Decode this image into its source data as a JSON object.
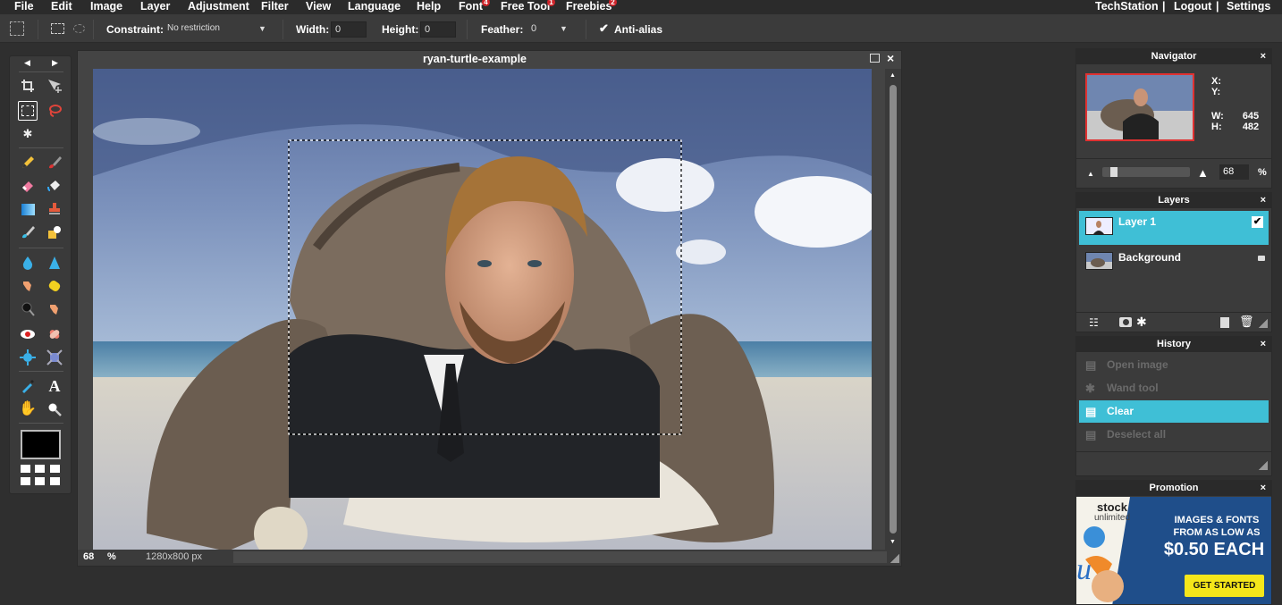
{
  "menu": {
    "items": [
      {
        "label": "File"
      },
      {
        "label": "Edit"
      },
      {
        "label": "Image"
      },
      {
        "label": "Layer"
      },
      {
        "label": "Adjustment"
      },
      {
        "label": "Filter"
      },
      {
        "label": "View"
      },
      {
        "label": "Language"
      },
      {
        "label": "Help"
      },
      {
        "label": "Font",
        "badge": "4"
      },
      {
        "label": "Free Tool",
        "badge": "1"
      },
      {
        "label": "Freebies",
        "badge": "2"
      }
    ],
    "right": {
      "site": "TechStation",
      "sep1": "|",
      "logout": "Logout",
      "sep2": "|",
      "settings": "Settings"
    }
  },
  "options": {
    "constraint_label": "Constraint:",
    "constraint_value": "No restriction",
    "width_label": "Width:",
    "width_value": "0",
    "height_label": "Height:",
    "height_value": "0",
    "feather_label": "Feather:",
    "feather_value": "0",
    "antialias_label": "Anti-alias",
    "antialias_checked": true
  },
  "toolbox": {
    "selected_tool": "rectangular-marquee",
    "foreground_color": "#000000",
    "tools": [
      "crop",
      "move",
      "marquee",
      "lasso",
      "magic-wand",
      "pencil",
      "brush",
      "eraser",
      "bucket",
      "gradient",
      "clone-stamp",
      "color-replace",
      "drawing",
      "blur",
      "sharpen",
      "smudge",
      "sponge",
      "dodge",
      "burn",
      "red-eye",
      "spot-heal",
      "bloat",
      "pinch",
      "color-picker",
      "type",
      "hand",
      "zoom"
    ]
  },
  "document": {
    "title": "ryan-turtle-example",
    "zoom": "68",
    "zoom_unit": "%",
    "size_info": "1280x800 px"
  },
  "navigator": {
    "title": "Navigator",
    "close": "×",
    "x_label": "X:",
    "y_label": "Y:",
    "x_value": "",
    "y_value": "",
    "w_label": "W:",
    "w_value": "645",
    "h_label": "H:",
    "h_value": "482",
    "zoom": "68",
    "zoom_unit": "%",
    "zoom_fraction": 0.1
  },
  "layers": {
    "title": "Layers",
    "close": "×",
    "items": [
      {
        "name": "Layer 1",
        "selected": true,
        "visible": true
      },
      {
        "name": "Background",
        "selected": false,
        "locked": true
      }
    ]
  },
  "history": {
    "title": "History",
    "close": "×",
    "items": [
      {
        "label": "Open image",
        "state": "undone"
      },
      {
        "label": "Wand tool",
        "state": "undone"
      },
      {
        "label": "Clear",
        "state": "current"
      },
      {
        "label": "Deselect all",
        "state": "undone"
      }
    ]
  },
  "promotion": {
    "title": "Promotion",
    "close": "×",
    "brand_top": "stock",
    "brand_bottom": "unlimited",
    "headline": "IMAGES & FONTS",
    "subline": "FROM AS LOW AS",
    "price": "$0.50 EACH",
    "cta": "GET STARTED"
  },
  "colors": {
    "accent": "#3fbfd6",
    "badge": "#d0242a",
    "panel_bg": "#3b3b3b",
    "cta_bg": "#f5e61a",
    "promo_bg": "#1f4e8a"
  }
}
